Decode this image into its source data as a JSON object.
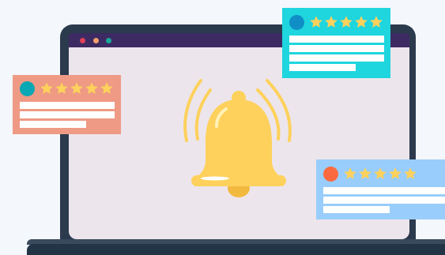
{
  "colors": {
    "page_background": "#f4f7fb",
    "laptop_frame": "#2b3a4d",
    "laptop_base": "#233446",
    "browser_bar": "#3d2a63",
    "screen": "#ede5ec",
    "bell": "#fdd15c",
    "bell_shadow": "#f2b93f",
    "star": "#fdd15c",
    "window_dots": [
      "#e0405a",
      "#f5a06b",
      "#1aa79a"
    ]
  },
  "icons": {
    "main": "bell-icon",
    "rating": "star-icon"
  },
  "review_cards": [
    {
      "id": "teal",
      "background": "#1fd5de",
      "avatar_color": "#0f8fc6",
      "rating": 5,
      "max_rating": 5
    },
    {
      "id": "salmon",
      "background": "#ee9a84",
      "avatar_color": "#0aa7b4",
      "rating": 5,
      "max_rating": 5
    },
    {
      "id": "blue",
      "background": "#99cdfb",
      "avatar_color": "#fb6a3f",
      "rating": 5,
      "max_rating": 5
    }
  ]
}
